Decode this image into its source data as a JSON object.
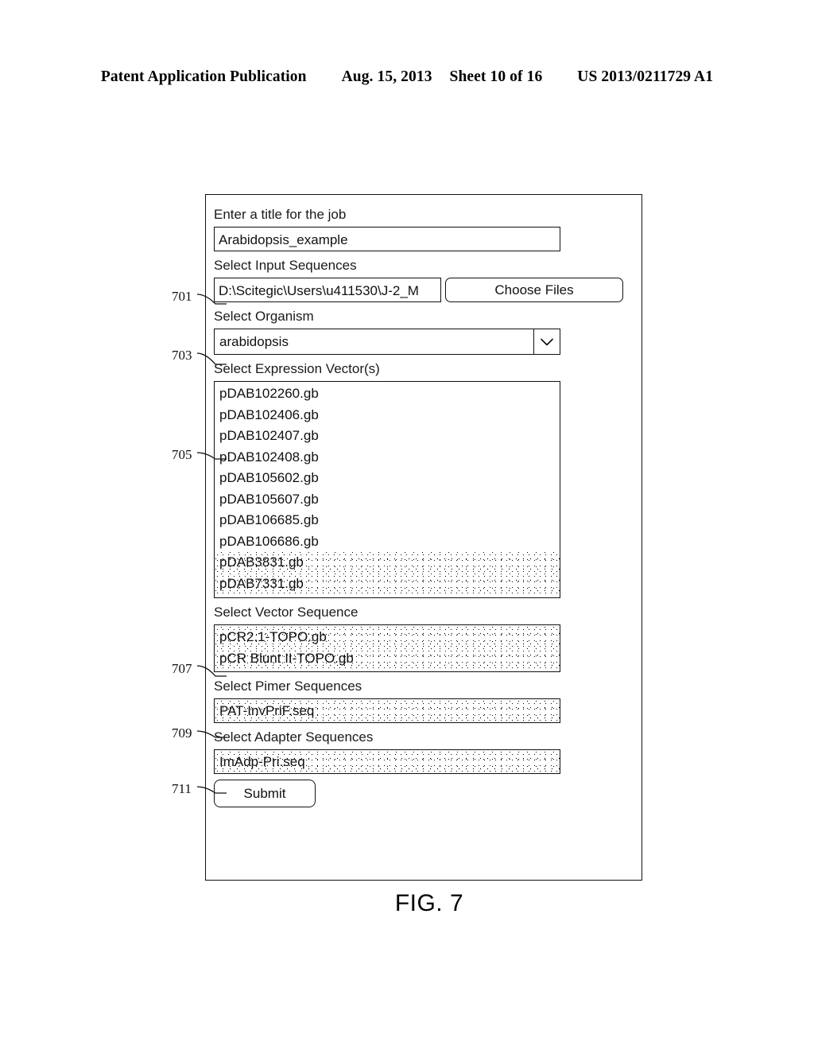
{
  "page_header": {
    "left": "Patent Application Publication",
    "date": "Aug. 15, 2013",
    "sheet": "Sheet 10 of 16",
    "patent_number": "US 2013/0211729 A1"
  },
  "figure": {
    "caption": "FIG. 7"
  },
  "form": {
    "title_label": "Enter a title for the job",
    "title_value": "Arabidopsis_example",
    "input_sequences_label": "Select Input Sequences",
    "input_sequences_value": "D:\\Scitegic\\Users\\u411530\\J-2_M",
    "choose_files_label": "Choose Files",
    "organism_label": "Select Organism",
    "organism_value": "arabidopsis",
    "expression_vectors_label": "Select Expression Vector(s)",
    "expression_vectors": [
      {
        "name": "pDAB102260.gb",
        "selected": false
      },
      {
        "name": "pDAB102406.gb",
        "selected": false
      },
      {
        "name": "pDAB102407.gb",
        "selected": false
      },
      {
        "name": "pDAB102408.gb",
        "selected": false
      },
      {
        "name": "pDAB105602.gb",
        "selected": false
      },
      {
        "name": "pDAB105607.gb",
        "selected": false
      },
      {
        "name": "pDAB106685.gb",
        "selected": false
      },
      {
        "name": "pDAB106686.gb",
        "selected": false
      },
      {
        "name": "pDAB3831.gb",
        "selected": true
      },
      {
        "name": "pDAB7331.gb",
        "selected": true
      }
    ],
    "vector_sequence_label": "Select Vector Sequence",
    "vector_sequences": [
      {
        "name": "pCR2.1-TOPO.gb",
        "selected": true
      },
      {
        "name": "pCR Blunt II-TOPO.gb",
        "selected": true
      }
    ],
    "primer_sequences_label": "Select Pimer Sequences",
    "primer_sequences": [
      {
        "name": "PAT-InvPriF.seq",
        "selected": true
      }
    ],
    "adapter_sequences_label": "Select Adapter Sequences",
    "adapter_sequences": [
      {
        "name": "ImAdp-Pri.seq",
        "selected": true
      }
    ],
    "submit_label": "Submit"
  },
  "callouts": [
    {
      "number": "701",
      "target": "input-sequences-field"
    },
    {
      "number": "703",
      "target": "organism-select"
    },
    {
      "number": "705",
      "target": "expression-vector-list"
    },
    {
      "number": "707",
      "target": "vector-sequence-list"
    },
    {
      "number": "709",
      "target": "primer-sequence-list"
    },
    {
      "number": "711",
      "target": "adapter-sequence-list"
    }
  ]
}
